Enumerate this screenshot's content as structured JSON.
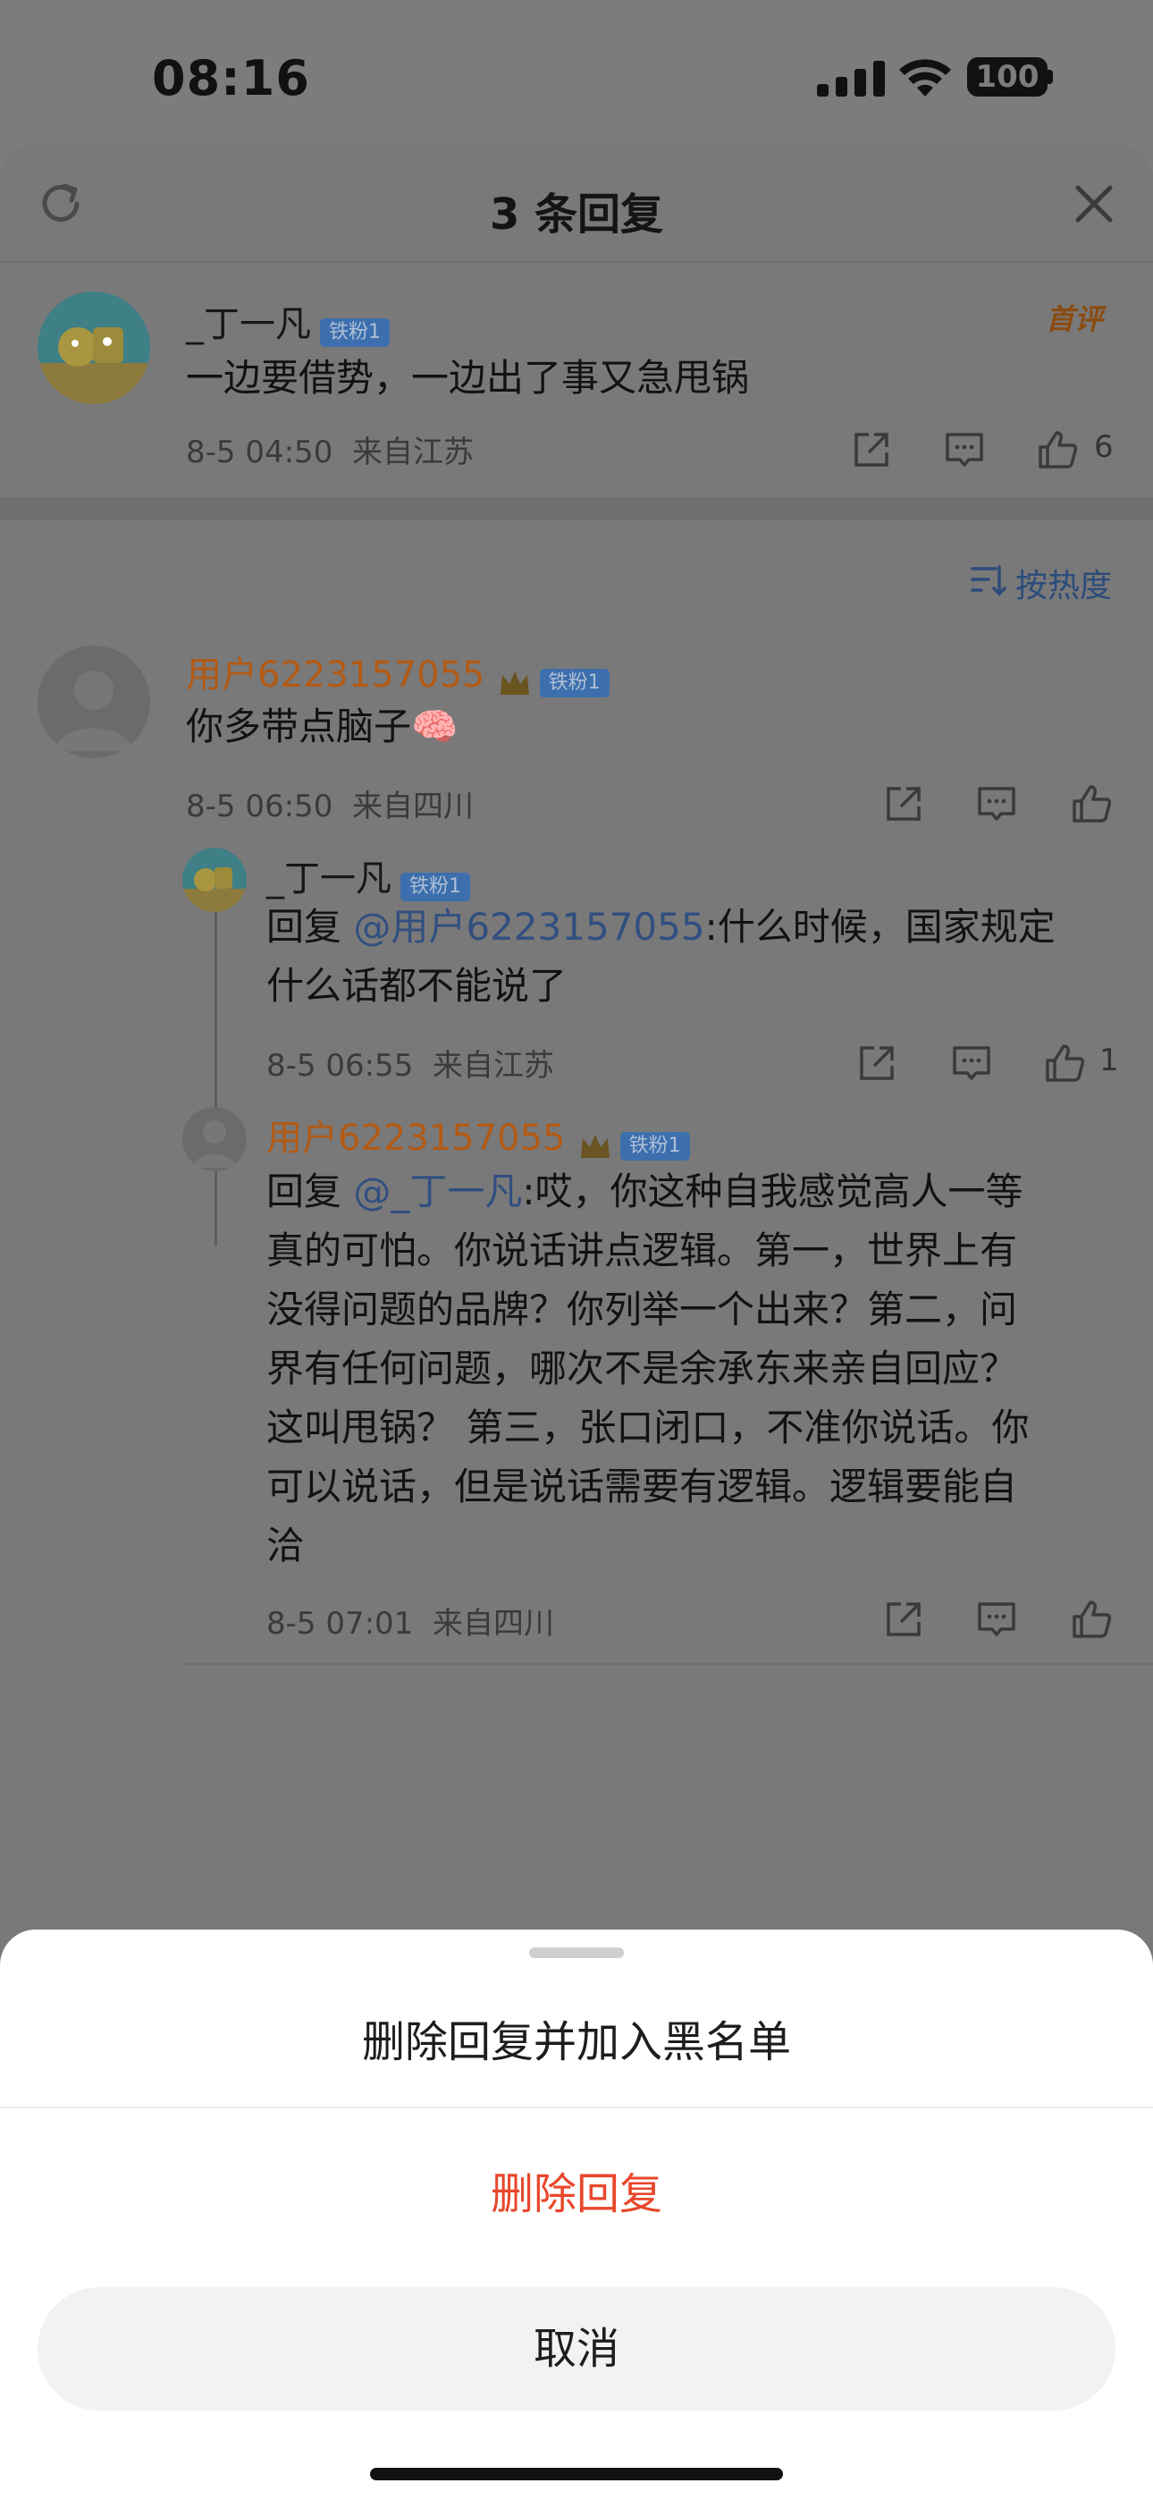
{
  "status_bar": {
    "time": "08:16",
    "battery": "100"
  },
  "header": {
    "title": "3 条回复"
  },
  "main_comment": {
    "username": "_丁一凡",
    "badge": "铁粉1",
    "tag": "首评",
    "text": "一边要借势，一边出了事又急甩锅",
    "time": "8-5 04:50",
    "location": "来自江苏",
    "likes": "6"
  },
  "sort": {
    "label": "按热度"
  },
  "replies": [
    {
      "username": "用户6223157055",
      "badge": "铁粉1",
      "text": "你多带点脑子🧠",
      "time": "8-5 06:50",
      "location": "来自四川"
    },
    {
      "username": "_丁一凡",
      "badge": "铁粉1",
      "reply_prefix": "回复 ",
      "mention": "@用户6223157055",
      "text_line1": ":什么时候，国家规定",
      "text_line2": "什么话都不能说了",
      "time": "8-5 06:55",
      "location": "来自江苏",
      "likes": "1"
    },
    {
      "username": "用户6223157055",
      "badge": "铁粉1",
      "reply_prefix": "回复 ",
      "mention": "@_丁一凡",
      "lines": [
        ":哎，你这种自我感觉高人一等",
        "真的可怕。你说话讲点逻辑。第一，世界上有",
        "没得问题的品牌？你列举一个出来？第二，问",
        "界有任何问题，哪次不是余承东来亲自回应？",
        "这叫甩锅？ 第三，张口闭口，不准你说话。你",
        "可以说话，但是说话需要有逻辑。逻辑要能自",
        "洽"
      ],
      "time": "8-5 07:01",
      "location": "来自四川"
    }
  ],
  "action_sheet": {
    "option_blacklist": "删除回复并加入黑名单",
    "option_delete": "删除回复",
    "cancel": "取消"
  }
}
